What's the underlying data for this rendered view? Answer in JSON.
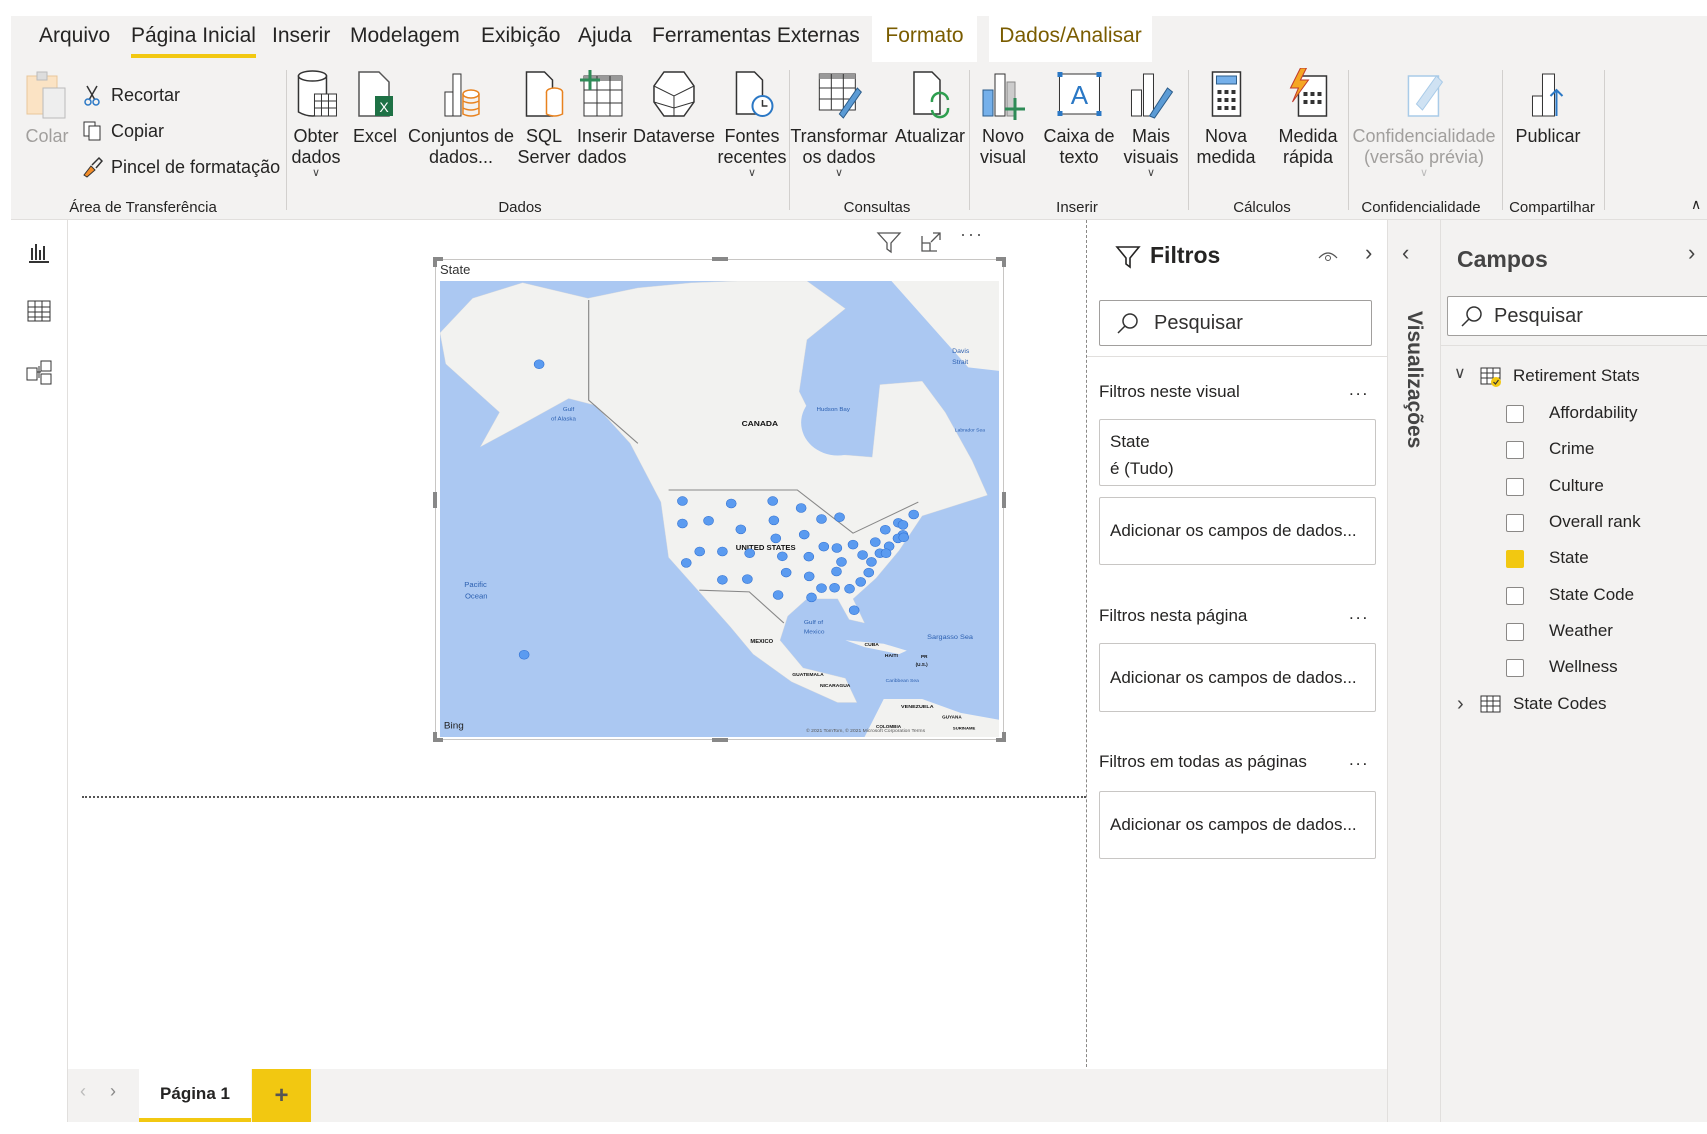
{
  "menu_tabs": [
    {
      "label": "Arquivo",
      "active": false
    },
    {
      "label": "Página Inicial",
      "active": true
    },
    {
      "label": "Inserir",
      "active": false
    },
    {
      "label": "Modelagem",
      "active": false
    },
    {
      "label": "Exibição",
      "active": false
    },
    {
      "label": "Ajuda",
      "active": false
    },
    {
      "label": "Ferramentas Externas",
      "active": false
    }
  ],
  "context_tabs": [
    {
      "label": "Formato"
    },
    {
      "label": "Dados/Analisar"
    }
  ],
  "ribbon": {
    "clipboard": {
      "paste": "Colar",
      "cut": "Recortar",
      "copy": "Copiar",
      "format_painter": "Pincel de formatação",
      "group": "Área de Transferência"
    },
    "data": {
      "group": "Dados",
      "get_data": [
        "Obter",
        "dados"
      ],
      "excel": "Excel",
      "datasets": [
        "Conjuntos de",
        "dados..."
      ],
      "sql": [
        "SQL",
        "Server"
      ],
      "enter_data": [
        "Inserir",
        "dados"
      ],
      "dataverse": "Dataverse",
      "recent": [
        "Fontes",
        "recentes"
      ]
    },
    "queries": {
      "group": "Consultas",
      "transform": [
        "Transformar",
        "os dados"
      ],
      "refresh": "Atualizar"
    },
    "insert": {
      "group": "Inserir",
      "new_visual": [
        "Novo",
        "visual"
      ],
      "text_box": [
        "Caixa de",
        "texto"
      ],
      "more_visuals": [
        "Mais",
        "visuais"
      ]
    },
    "calculations": {
      "group": "Cálculos",
      "new_measure": [
        "Nova",
        "medida"
      ],
      "quick_measure": [
        "Medida",
        "rápida"
      ]
    },
    "sensitivity": {
      "group": "Confidencialidade",
      "label": [
        "Confidencialidade",
        "(versão prévia)"
      ]
    },
    "share": {
      "group": "Compartilhar",
      "publish": "Publicar"
    }
  },
  "visual": {
    "title": "State",
    "map_labels": {
      "canada": "CANADA",
      "us": "UNITED STATES",
      "mexico": "MEXICO",
      "cuba": "CUBA",
      "haiti": "HAITI",
      "pr": "PR",
      "pr2": "(U.S.)",
      "guatemala": "GUATEMALA",
      "nicaragua": "NICARAGUA",
      "venezuela": "VENEZUELA",
      "guyana": "GUYANA",
      "colombia": "COLOMBIA",
      "suriname": "SURINAME",
      "hudson": "Hudson Bay",
      "gulf_alaska1": "Gulf",
      "gulf_alaska2": "of Alaska",
      "davis1": "Davis",
      "davis2": "Strait",
      "labrador": "Labrador Sea",
      "pacific1": "Pacific",
      "pacific2": "Ocean",
      "gulf_mexico1": "Gulf of",
      "gulf_mexico2": "Mexico",
      "sargasso": "Sargasso Sea",
      "caribbean": "Caribbean Sea",
      "bing": "Bing",
      "copyright": "© 2021 TomTom, © 2021 Microsoft Corporation  Terms"
    },
    "marker_color": "#5b9bf0"
  },
  "filters": {
    "title": "Filtros",
    "search_placeholder": "Pesquisar",
    "visual_section": "Filtros neste visual",
    "state_filter": {
      "field": "State",
      "value": "é (Tudo)"
    },
    "add_fields": "Adicionar os campos de dados...",
    "page_section": "Filtros nesta página",
    "all_pages_section": "Filtros em todas as páginas",
    "more": "..."
  },
  "visualizations": {
    "label": "Visualizações"
  },
  "fields": {
    "title": "Campos",
    "search_placeholder": "Pesquisar",
    "tables": [
      {
        "name": "Retirement Stats",
        "expanded": true,
        "items": [
          {
            "label": "Affordability",
            "checked": false
          },
          {
            "label": "Crime",
            "checked": false
          },
          {
            "label": "Culture",
            "checked": false
          },
          {
            "label": "Overall rank",
            "checked": false
          },
          {
            "label": "State",
            "checked": true
          },
          {
            "label": "State Code",
            "checked": false
          },
          {
            "label": "Weather",
            "checked": false
          },
          {
            "label": "Wellness",
            "checked": false
          }
        ]
      },
      {
        "name": "State Codes",
        "expanded": false
      }
    ]
  },
  "pages": {
    "tabs": [
      {
        "label": "Página 1",
        "active": true
      }
    ],
    "add": "+"
  },
  "colors": {
    "accent": "#f2c811",
    "context_tab_text": "#7a5c00",
    "ocean": "#abc8f2",
    "land": "#f2f2f0"
  }
}
